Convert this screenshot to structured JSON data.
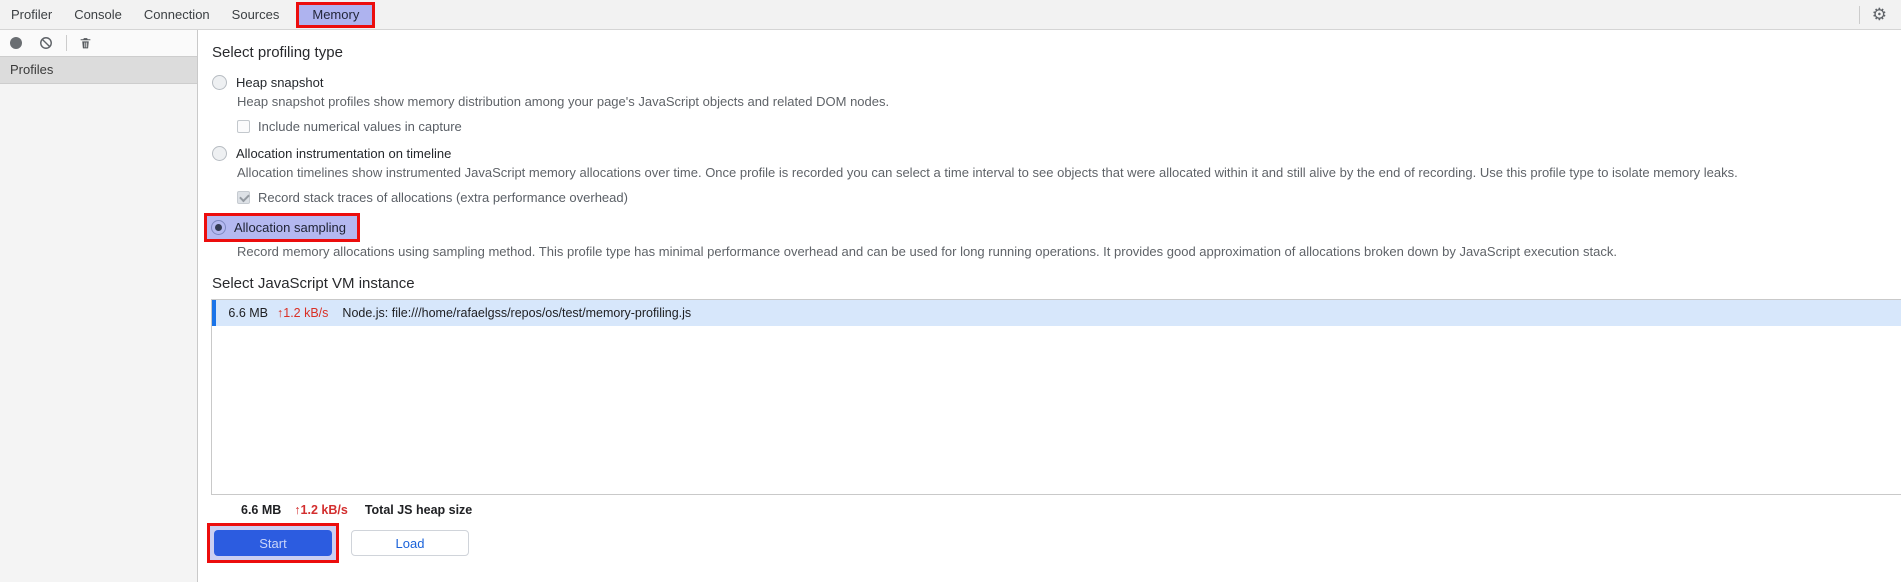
{
  "tabs": {
    "items": [
      {
        "label": "Profiler",
        "selected": false
      },
      {
        "label": "Console",
        "selected": false
      },
      {
        "label": "Connection",
        "selected": false
      },
      {
        "label": "Sources",
        "selected": false
      },
      {
        "label": "Memory",
        "selected": true,
        "annotated": true
      }
    ]
  },
  "toolbar": {
    "icons": [
      "record-icon",
      "clear-icon",
      "delete-icon"
    ]
  },
  "sidebar": {
    "header": "Profiles"
  },
  "main": {
    "profiling": {
      "title": "Select profiling type",
      "options": [
        {
          "label": "Heap snapshot",
          "desc": "Heap snapshot profiles show memory distribution among your page's JavaScript objects and related DOM nodes.",
          "selected": false,
          "sub_checkbox": {
            "label": "Include numerical values in capture",
            "checked": false,
            "disabled": false
          }
        },
        {
          "label": "Allocation instrumentation on timeline",
          "desc": "Allocation timelines show instrumented JavaScript memory allocations over time. Once profile is recorded you can select a time interval to see objects that were allocated within it and still alive by the end of recording. Use this profile type to isolate memory leaks.",
          "selected": false,
          "sub_checkbox": {
            "label": "Record stack traces of allocations (extra performance overhead)",
            "checked": true,
            "disabled": true
          }
        },
        {
          "label": "Allocation sampling",
          "desc": "Record memory allocations using sampling method. This profile type has minimal performance overhead and can be used for long running operations. It provides good approximation of allocations broken down by JavaScript execution stack.",
          "selected": true,
          "annotated": true
        }
      ]
    },
    "vm": {
      "title": "Select JavaScript VM instance",
      "instances": [
        {
          "size": "6.6 MB",
          "rate": "1.2 kB/s",
          "name": "Node.js: file:///home/rafaelgss/repos/os/test/memory-profiling.js",
          "selected": true
        }
      ],
      "total": {
        "size": "6.6 MB",
        "rate": "1.2 kB/s",
        "label": "Total JS heap size"
      }
    },
    "actions": {
      "start": "Start",
      "load": "Load"
    }
  },
  "icons": {
    "gear": "⚙",
    "up_arrow": "↑"
  },
  "colors": {
    "annotation_red": "#ec0d0d",
    "tab_highlight": "#aeb3ef",
    "selection_blue": "#1a73e8",
    "selected_row_bg": "#d7e7fb",
    "rate_red": "#d93025",
    "start_button_bg": "#2c5ce0",
    "load_button_text": "#1a62d9"
  }
}
